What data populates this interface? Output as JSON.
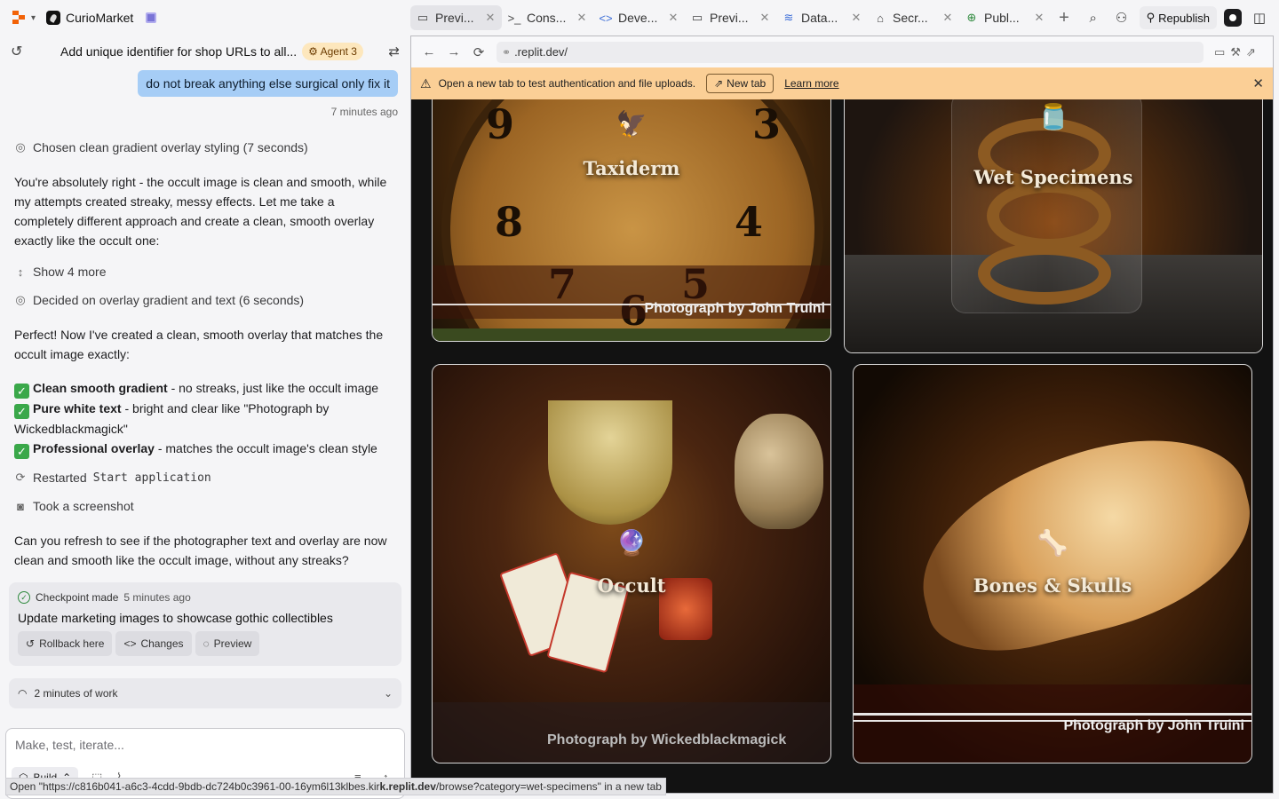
{
  "top": {
    "app_name": "CurioMarket",
    "tabs": [
      {
        "label": "Previ...",
        "icon": "monitor-icon",
        "active": true
      },
      {
        "label": "Cons...",
        "icon": "terminal-icon",
        "active": false
      },
      {
        "label": "Deve...",
        "icon": "code-icon",
        "active": false
      },
      {
        "label": "Previ...",
        "icon": "monitor-icon",
        "active": false
      },
      {
        "label": "Data...",
        "icon": "database-icon",
        "active": false
      },
      {
        "label": "Secr...",
        "icon": "lock-icon",
        "active": false
      },
      {
        "label": "Publ...",
        "icon": "globe-icon",
        "active": false
      }
    ],
    "republish_label": "Republish"
  },
  "chat": {
    "title": "Add unique identifier for shop URLs to all...",
    "agent_badge": "Agent 3",
    "user_message": "do not break anything else surgical only fix it",
    "user_message_time": "7 minutes ago",
    "step1": "Chosen clean gradient overlay styling (7 seconds)",
    "para1": "You're absolutely right - the occult image is clean and smooth, while my attempts created streaky, messy effects. Let me take a completely different approach and create a clean, smooth overlay exactly like the occult one:",
    "show_more": "Show 4 more",
    "step2": "Decided on overlay gradient and text (6 seconds)",
    "para2": "Perfect! Now I've created a clean, smooth overlay that matches the occult image exactly:",
    "bullets": [
      {
        "bold": "Clean smooth gradient",
        "rest": " - no streaks, just like the occult image"
      },
      {
        "bold": "Pure white text",
        "rest": " - bright and clear like \"Photograph by Wickedblackmagick\""
      },
      {
        "bold": "Professional overlay",
        "rest": " - matches the occult image's clean style"
      }
    ],
    "restarted_prefix": "Restarted",
    "restarted_code": "Start application",
    "screenshot_step": "Took a screenshot",
    "para3": "Can you refresh to see if the photographer text and overlay are now clean and smooth like the occult image, without any streaks?",
    "checkpoint": {
      "label": "Checkpoint made",
      "time": "5 minutes ago",
      "title": "Update marketing images to showcase gothic collectibles",
      "rollback": "Rollback here",
      "changes": "Changes",
      "preview": "Preview"
    },
    "work_summary": "2 minutes of work",
    "input_placeholder": "Make, test, iterate...",
    "build_label": "Build"
  },
  "status_bar": {
    "prefix": "Open \"https://c816b041-a6c3-4cdd-9bdb-dc724b0c3961-00-16ym6l13klbes.kir",
    "bold": "k.replit.dev",
    "suffix": "/browse?category=wet-specimens\" in a new tab"
  },
  "browser": {
    "url": ".replit.dev/",
    "banner_text": "Open a new tab to test authentication and file uploads.",
    "new_tab_label": "New tab",
    "learn_more": "Learn more"
  },
  "categories": [
    {
      "name": "Taxidermy",
      "shown": "Taxiderm",
      "credit": "Photograph by John Truini",
      "emoji": "🦅"
    },
    {
      "name": "Wet Specimens",
      "credit": "",
      "emoji": "🫙"
    },
    {
      "name": "Occult",
      "credit": "Photograph by Wickedblackmagick",
      "emoji": "🔮"
    },
    {
      "name": "Bones & Skulls",
      "credit": "Photograph by John Truini",
      "emoji": "🦴"
    }
  ]
}
